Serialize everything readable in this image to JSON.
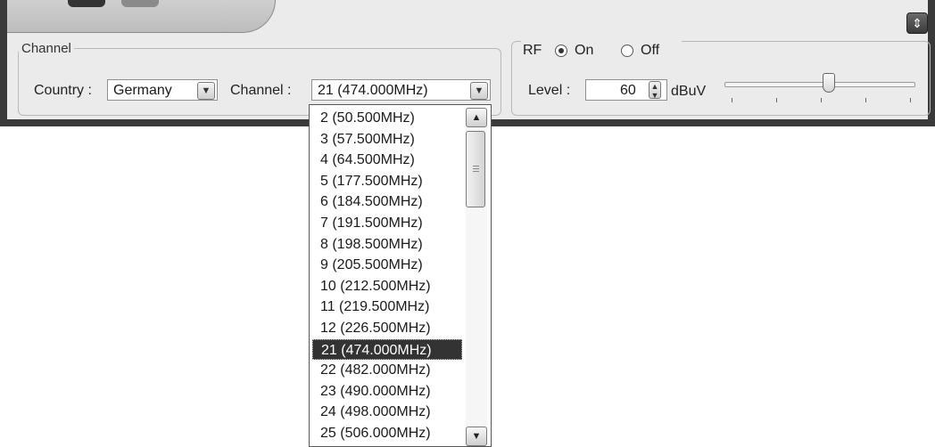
{
  "window": {
    "corner_icon": "resize-vertical-icon",
    "corner_glyph": "⇕"
  },
  "channel_group": {
    "legend": "Channel",
    "country_label": "Country :",
    "country_value": "Germany",
    "channel_label": "Channel :",
    "channel_value": "21 (474.000MHz)"
  },
  "rf_group": {
    "rf_label": "RF",
    "on_label": "On",
    "off_label": "Off",
    "selected": "On",
    "level_label": "Level :",
    "level_value": "60",
    "unit": "dBuV",
    "slider_fraction": 0.55
  },
  "dropdown": {
    "selected": "21 (474.000MHz)",
    "items": [
      "2 (50.500MHz)",
      "3 (57.500MHz)",
      "4 (64.500MHz)",
      "5 (177.500MHz)",
      "6 (184.500MHz)",
      "7 (191.500MHz)",
      "8 (198.500MHz)",
      "9 (205.500MHz)",
      "10 (212.500MHz)",
      "11 (219.500MHz)",
      "12 (226.500MHz)",
      "21 (474.000MHz)",
      "22 (482.000MHz)",
      "23 (490.000MHz)",
      "24 (498.000MHz)",
      "25 (506.000MHz)"
    ]
  }
}
